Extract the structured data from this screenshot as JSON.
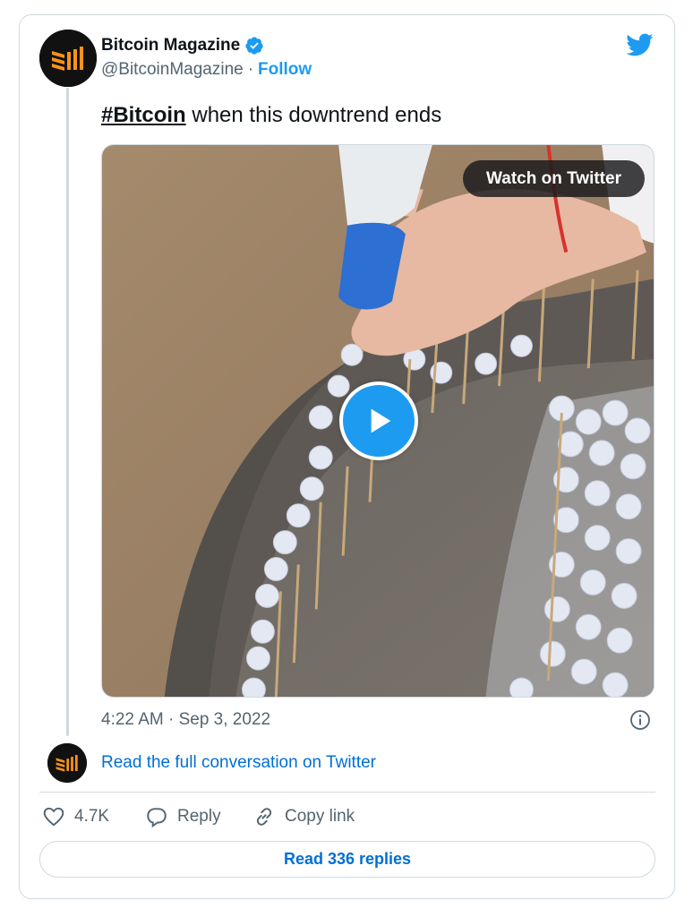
{
  "author": {
    "name": "Bitcoin Magazine",
    "handle": "@BitcoinMagazine",
    "separator": "·",
    "follow_label": "Follow",
    "verified": true
  },
  "tweet": {
    "hashtag": "#Bitcoin",
    "text": " when this downtrend ends"
  },
  "media": {
    "watch_label": "Watch on Twitter",
    "type": "video"
  },
  "meta": {
    "timestamp": "4:22 AM · Sep 3, 2022"
  },
  "conversation": {
    "label": "Read the full conversation on Twitter"
  },
  "actions": {
    "likes": "4.7K",
    "reply_label": "Reply",
    "copy_label": "Copy link"
  },
  "replies": {
    "label": "Read 336 replies"
  },
  "colors": {
    "accent": "#1d9bf0",
    "link": "#006fd6",
    "muted": "#536471",
    "border": "#cfd9de"
  },
  "icons": [
    "bitcoin-magazine-logo",
    "verified-badge-icon",
    "twitter-bird-icon",
    "play-icon",
    "info-icon",
    "heart-icon",
    "reply-icon",
    "link-icon"
  ]
}
